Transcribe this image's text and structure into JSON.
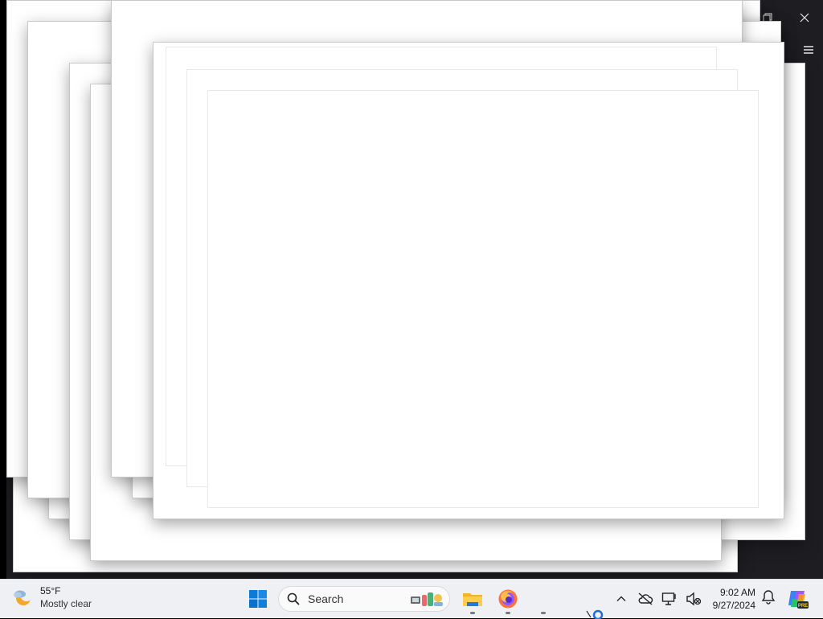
{
  "window": {
    "restore_label": "Restore",
    "close_label": "Close",
    "menu_label": "Menu"
  },
  "taskbar": {
    "weather": {
      "temperature": "55°F",
      "condition": "Mostly clear",
      "icon": "moon-cloud-icon"
    },
    "start": {
      "icon": "windows-logo-icon"
    },
    "search": {
      "placeholder": "Search",
      "icon": "search-icon"
    },
    "pinned_apps": [
      {
        "name": "File Explorer",
        "icon": "folder-icon",
        "running": true
      },
      {
        "name": "Firefox",
        "icon": "firefox-icon",
        "running": true
      }
    ],
    "tray": [
      {
        "name": "Show hidden icons",
        "icon": "chevron-up-icon"
      },
      {
        "name": "OneDrive",
        "icon": "cloud-offline-icon"
      },
      {
        "name": "Network",
        "icon": "monitor-network-icon"
      },
      {
        "name": "Volume",
        "icon": "speaker-muted-icon"
      }
    ],
    "clock": {
      "time": "9:02 AM",
      "date": "9/27/2024"
    },
    "notifications": {
      "icon": "bell-icon"
    },
    "copilot": {
      "icon": "copilot-icon",
      "badge": "PRE"
    }
  },
  "colors": {
    "taskbar_bg": "#eef0f4",
    "window_bg": "#1e1e22",
    "accent_blue": "#0078d4"
  }
}
